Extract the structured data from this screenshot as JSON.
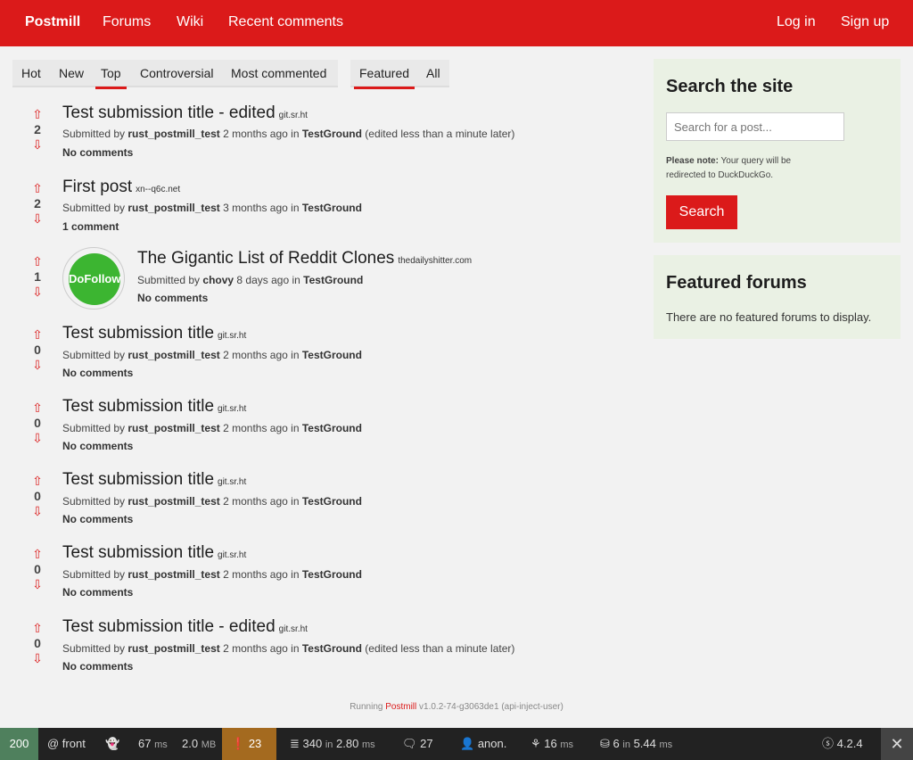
{
  "nav": {
    "brand": "Postmill",
    "links": [
      "Forums",
      "Wiki",
      "Recent comments"
    ],
    "login": "Log in",
    "signup": "Sign up"
  },
  "sort_tabs": [
    "Hot",
    "New",
    "Top",
    "Controversial",
    "Most commented"
  ],
  "filter_tabs": [
    "Featured",
    "All"
  ],
  "submissions": [
    {
      "title": "Test submission title - edited",
      "domain": "git.sr.ht",
      "score": "2",
      "submitted_by": "Submitted by",
      "user": "rust_postmill_test",
      "time": "2 months ago",
      "in": "in",
      "forum": "TestGround",
      "edited": "(edited less than a minute later)",
      "comments": "No comments"
    },
    {
      "title": "First post",
      "domain": "xn--q6c.net",
      "score": "2",
      "submitted_by": "Submitted by",
      "user": "rust_postmill_test",
      "time": "3 months ago",
      "in": "in",
      "forum": "TestGround",
      "edited": "",
      "comments": "1 comment"
    },
    {
      "title": "The Gigantic List of Reddit Clones",
      "domain": "thedailyshitter.com",
      "score": "1",
      "submitted_by": "Submitted by",
      "user": "chovy",
      "time": "8 days ago",
      "in": "in",
      "forum": "TestGround",
      "edited": "",
      "comments": "No comments",
      "thumb": "DoFollow"
    },
    {
      "title": "Test submission title",
      "domain": "git.sr.ht",
      "score": "0",
      "submitted_by": "Submitted by",
      "user": "rust_postmill_test",
      "time": "2 months ago",
      "in": "in",
      "forum": "TestGround",
      "edited": "",
      "comments": "No comments"
    },
    {
      "title": "Test submission title",
      "domain": "git.sr.ht",
      "score": "0",
      "submitted_by": "Submitted by",
      "user": "rust_postmill_test",
      "time": "2 months ago",
      "in": "in",
      "forum": "TestGround",
      "edited": "",
      "comments": "No comments"
    },
    {
      "title": "Test submission title",
      "domain": "git.sr.ht",
      "score": "0",
      "submitted_by": "Submitted by",
      "user": "rust_postmill_test",
      "time": "2 months ago",
      "in": "in",
      "forum": "TestGround",
      "edited": "",
      "comments": "No comments"
    },
    {
      "title": "Test submission title",
      "domain": "git.sr.ht",
      "score": "0",
      "submitted_by": "Submitted by",
      "user": "rust_postmill_test",
      "time": "2 months ago",
      "in": "in",
      "forum": "TestGround",
      "edited": "",
      "comments": "No comments"
    },
    {
      "title": "Test submission title - edited",
      "domain": "git.sr.ht",
      "score": "0",
      "submitted_by": "Submitted by",
      "user": "rust_postmill_test",
      "time": "2 months ago",
      "in": "in",
      "forum": "TestGround",
      "edited": "(edited less than a minute later)",
      "comments": "No comments"
    }
  ],
  "sidebar": {
    "search_title": "Search the site",
    "search_placeholder": "Search for a post...",
    "note_label": "Please note:",
    "note_text": "Your query will be redirected to DuckDuckGo.",
    "search_button": "Search",
    "featured_title": "Featured forums",
    "featured_empty": "There are no featured forums to display."
  },
  "footer": {
    "running": "Running",
    "app": "Postmill",
    "version": "v1.0.2-74-g3063de1 (api-inject-user)"
  },
  "debug_toolbar": {
    "status": "200",
    "route": "@ front",
    "time": "67",
    "time_unit": "ms",
    "memory": "2.0",
    "memory_unit": "MB",
    "warnings": "23",
    "cache_calls": "340",
    "cache_in": "in",
    "cache_time": "2.80",
    "cache_unit": "ms",
    "translations": "27",
    "user": "anon.",
    "twig": "16",
    "twig_unit": "ms",
    "db_queries": "6",
    "db_in": "in",
    "db_time": "5.44",
    "db_unit": "ms",
    "symfony_version": "4.2.4",
    "close": "✕"
  },
  "colors": {
    "brand": "#db1a1a",
    "sidebar_bg": "#eaf1e4",
    "page_bg": "#f2f2f2"
  }
}
